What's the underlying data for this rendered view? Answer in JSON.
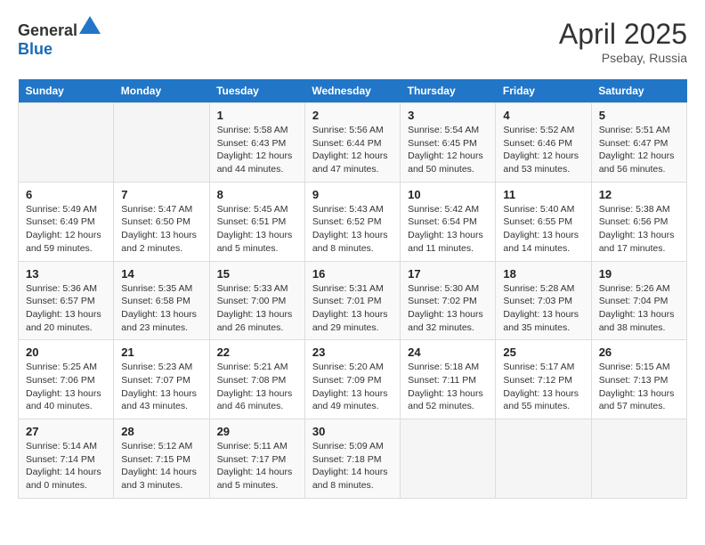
{
  "header": {
    "logo_general": "General",
    "logo_blue": "Blue",
    "month": "April 2025",
    "location": "Psebay, Russia"
  },
  "days_of_week": [
    "Sunday",
    "Monday",
    "Tuesday",
    "Wednesday",
    "Thursday",
    "Friday",
    "Saturday"
  ],
  "weeks": [
    [
      {
        "day": "",
        "info": ""
      },
      {
        "day": "",
        "info": ""
      },
      {
        "day": "1",
        "info": "Sunrise: 5:58 AM\nSunset: 6:43 PM\nDaylight: 12 hours and 44 minutes."
      },
      {
        "day": "2",
        "info": "Sunrise: 5:56 AM\nSunset: 6:44 PM\nDaylight: 12 hours and 47 minutes."
      },
      {
        "day": "3",
        "info": "Sunrise: 5:54 AM\nSunset: 6:45 PM\nDaylight: 12 hours and 50 minutes."
      },
      {
        "day": "4",
        "info": "Sunrise: 5:52 AM\nSunset: 6:46 PM\nDaylight: 12 hours and 53 minutes."
      },
      {
        "day": "5",
        "info": "Sunrise: 5:51 AM\nSunset: 6:47 PM\nDaylight: 12 hours and 56 minutes."
      }
    ],
    [
      {
        "day": "6",
        "info": "Sunrise: 5:49 AM\nSunset: 6:49 PM\nDaylight: 12 hours and 59 minutes."
      },
      {
        "day": "7",
        "info": "Sunrise: 5:47 AM\nSunset: 6:50 PM\nDaylight: 13 hours and 2 minutes."
      },
      {
        "day": "8",
        "info": "Sunrise: 5:45 AM\nSunset: 6:51 PM\nDaylight: 13 hours and 5 minutes."
      },
      {
        "day": "9",
        "info": "Sunrise: 5:43 AM\nSunset: 6:52 PM\nDaylight: 13 hours and 8 minutes."
      },
      {
        "day": "10",
        "info": "Sunrise: 5:42 AM\nSunset: 6:54 PM\nDaylight: 13 hours and 11 minutes."
      },
      {
        "day": "11",
        "info": "Sunrise: 5:40 AM\nSunset: 6:55 PM\nDaylight: 13 hours and 14 minutes."
      },
      {
        "day": "12",
        "info": "Sunrise: 5:38 AM\nSunset: 6:56 PM\nDaylight: 13 hours and 17 minutes."
      }
    ],
    [
      {
        "day": "13",
        "info": "Sunrise: 5:36 AM\nSunset: 6:57 PM\nDaylight: 13 hours and 20 minutes."
      },
      {
        "day": "14",
        "info": "Sunrise: 5:35 AM\nSunset: 6:58 PM\nDaylight: 13 hours and 23 minutes."
      },
      {
        "day": "15",
        "info": "Sunrise: 5:33 AM\nSunset: 7:00 PM\nDaylight: 13 hours and 26 minutes."
      },
      {
        "day": "16",
        "info": "Sunrise: 5:31 AM\nSunset: 7:01 PM\nDaylight: 13 hours and 29 minutes."
      },
      {
        "day": "17",
        "info": "Sunrise: 5:30 AM\nSunset: 7:02 PM\nDaylight: 13 hours and 32 minutes."
      },
      {
        "day": "18",
        "info": "Sunrise: 5:28 AM\nSunset: 7:03 PM\nDaylight: 13 hours and 35 minutes."
      },
      {
        "day": "19",
        "info": "Sunrise: 5:26 AM\nSunset: 7:04 PM\nDaylight: 13 hours and 38 minutes."
      }
    ],
    [
      {
        "day": "20",
        "info": "Sunrise: 5:25 AM\nSunset: 7:06 PM\nDaylight: 13 hours and 40 minutes."
      },
      {
        "day": "21",
        "info": "Sunrise: 5:23 AM\nSunset: 7:07 PM\nDaylight: 13 hours and 43 minutes."
      },
      {
        "day": "22",
        "info": "Sunrise: 5:21 AM\nSunset: 7:08 PM\nDaylight: 13 hours and 46 minutes."
      },
      {
        "day": "23",
        "info": "Sunrise: 5:20 AM\nSunset: 7:09 PM\nDaylight: 13 hours and 49 minutes."
      },
      {
        "day": "24",
        "info": "Sunrise: 5:18 AM\nSunset: 7:11 PM\nDaylight: 13 hours and 52 minutes."
      },
      {
        "day": "25",
        "info": "Sunrise: 5:17 AM\nSunset: 7:12 PM\nDaylight: 13 hours and 55 minutes."
      },
      {
        "day": "26",
        "info": "Sunrise: 5:15 AM\nSunset: 7:13 PM\nDaylight: 13 hours and 57 minutes."
      }
    ],
    [
      {
        "day": "27",
        "info": "Sunrise: 5:14 AM\nSunset: 7:14 PM\nDaylight: 14 hours and 0 minutes."
      },
      {
        "day": "28",
        "info": "Sunrise: 5:12 AM\nSunset: 7:15 PM\nDaylight: 14 hours and 3 minutes."
      },
      {
        "day": "29",
        "info": "Sunrise: 5:11 AM\nSunset: 7:17 PM\nDaylight: 14 hours and 5 minutes."
      },
      {
        "day": "30",
        "info": "Sunrise: 5:09 AM\nSunset: 7:18 PM\nDaylight: 14 hours and 8 minutes."
      },
      {
        "day": "",
        "info": ""
      },
      {
        "day": "",
        "info": ""
      },
      {
        "day": "",
        "info": ""
      }
    ]
  ]
}
